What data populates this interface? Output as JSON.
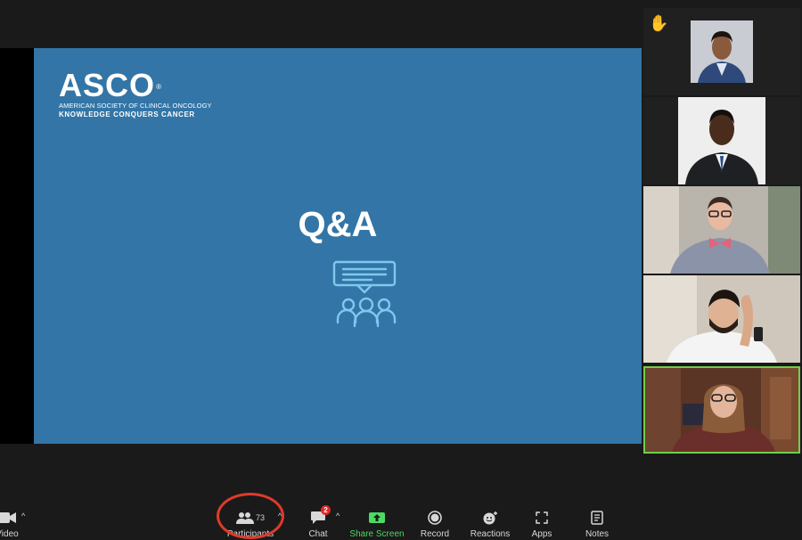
{
  "slide": {
    "logo": {
      "name": "ASCO",
      "registered": "®",
      "line1": "AMERICAN SOCIETY OF CLINICAL ONCOLOGY",
      "line2": "KNOWLEDGE CONQUERS CANCER"
    },
    "title": "Q&A",
    "icon": "qa-audience-icon"
  },
  "gallery": {
    "participants": [
      {
        "raised_hand": true,
        "hand_glyph": "✋"
      },
      {
        "raised_hand": false
      },
      {
        "raised_hand": false
      },
      {
        "raised_hand": false
      },
      {
        "raised_hand": false,
        "speaking": true
      }
    ]
  },
  "toolbar": {
    "video_label": "Video",
    "participants_label": "Participants",
    "participants_count": "73",
    "chat_label": "Chat",
    "chat_badge": "2",
    "share_label": "Share Screen",
    "record_label": "Record",
    "reactions_label": "Reactions",
    "apps_label": "Apps",
    "notes_label": "Notes"
  },
  "colors": {
    "slide_bg": "#3375a6",
    "active_speaker_border": "#6fcf4a",
    "share_green": "#4cd964",
    "annotation_red": "#e03a2a",
    "badge_red": "#e02828"
  }
}
